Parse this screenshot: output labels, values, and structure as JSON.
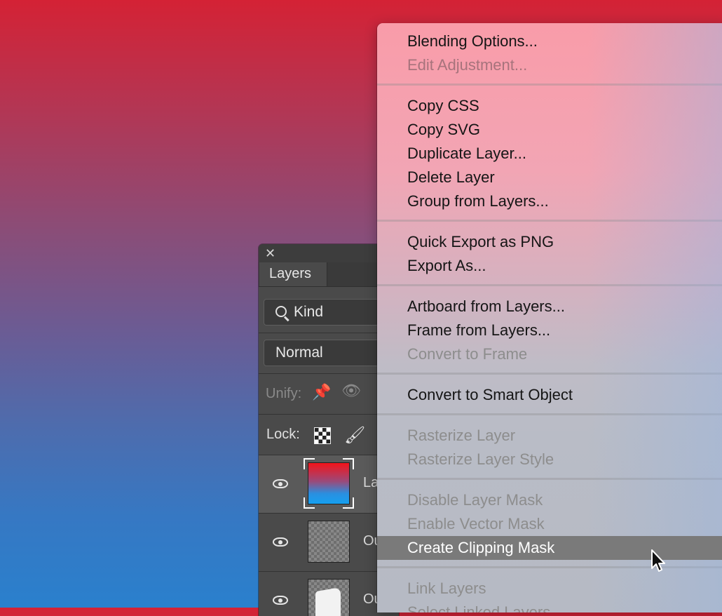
{
  "layers_panel": {
    "close_glyph": "✕",
    "tab_label": "Layers",
    "filter_kind": "Kind",
    "blend_mode": "Normal",
    "unify_label": "Unify:",
    "lock_label": "Lock:",
    "layers": [
      {
        "name": "La",
        "thumb": "gradient",
        "selected": true
      },
      {
        "name": "Ou",
        "thumb": "transparent",
        "selected": false
      },
      {
        "name": "Ou",
        "thumb": "shape",
        "selected": false
      }
    ]
  },
  "context_menu": {
    "items": [
      {
        "label": "Blending Options...",
        "enabled": true
      },
      {
        "label": "Edit Adjustment...",
        "enabled": false
      },
      {
        "label": "Copy CSS",
        "enabled": true
      },
      {
        "label": "Copy SVG",
        "enabled": true
      },
      {
        "label": "Duplicate Layer...",
        "enabled": true
      },
      {
        "label": "Delete Layer",
        "enabled": true
      },
      {
        "label": "Group from Layers...",
        "enabled": true
      },
      {
        "label": "Quick Export as PNG",
        "enabled": true
      },
      {
        "label": "Export As...",
        "enabled": true
      },
      {
        "label": "Artboard from Layers...",
        "enabled": true
      },
      {
        "label": "Frame from Layers...",
        "enabled": true
      },
      {
        "label": "Convert to Frame",
        "enabled": false
      },
      {
        "label": "Convert to Smart Object",
        "enabled": true
      },
      {
        "label": "Rasterize Layer",
        "enabled": false
      },
      {
        "label": "Rasterize Layer Style",
        "enabled": false
      },
      {
        "label": "Disable Layer Mask",
        "enabled": false
      },
      {
        "label": "Enable Vector Mask",
        "enabled": false
      },
      {
        "label": "Create Clipping Mask",
        "enabled": true,
        "highlighted": true
      },
      {
        "label": "Link Layers",
        "enabled": false
      },
      {
        "label": "Select Linked Layers",
        "enabled": false
      }
    ]
  }
}
